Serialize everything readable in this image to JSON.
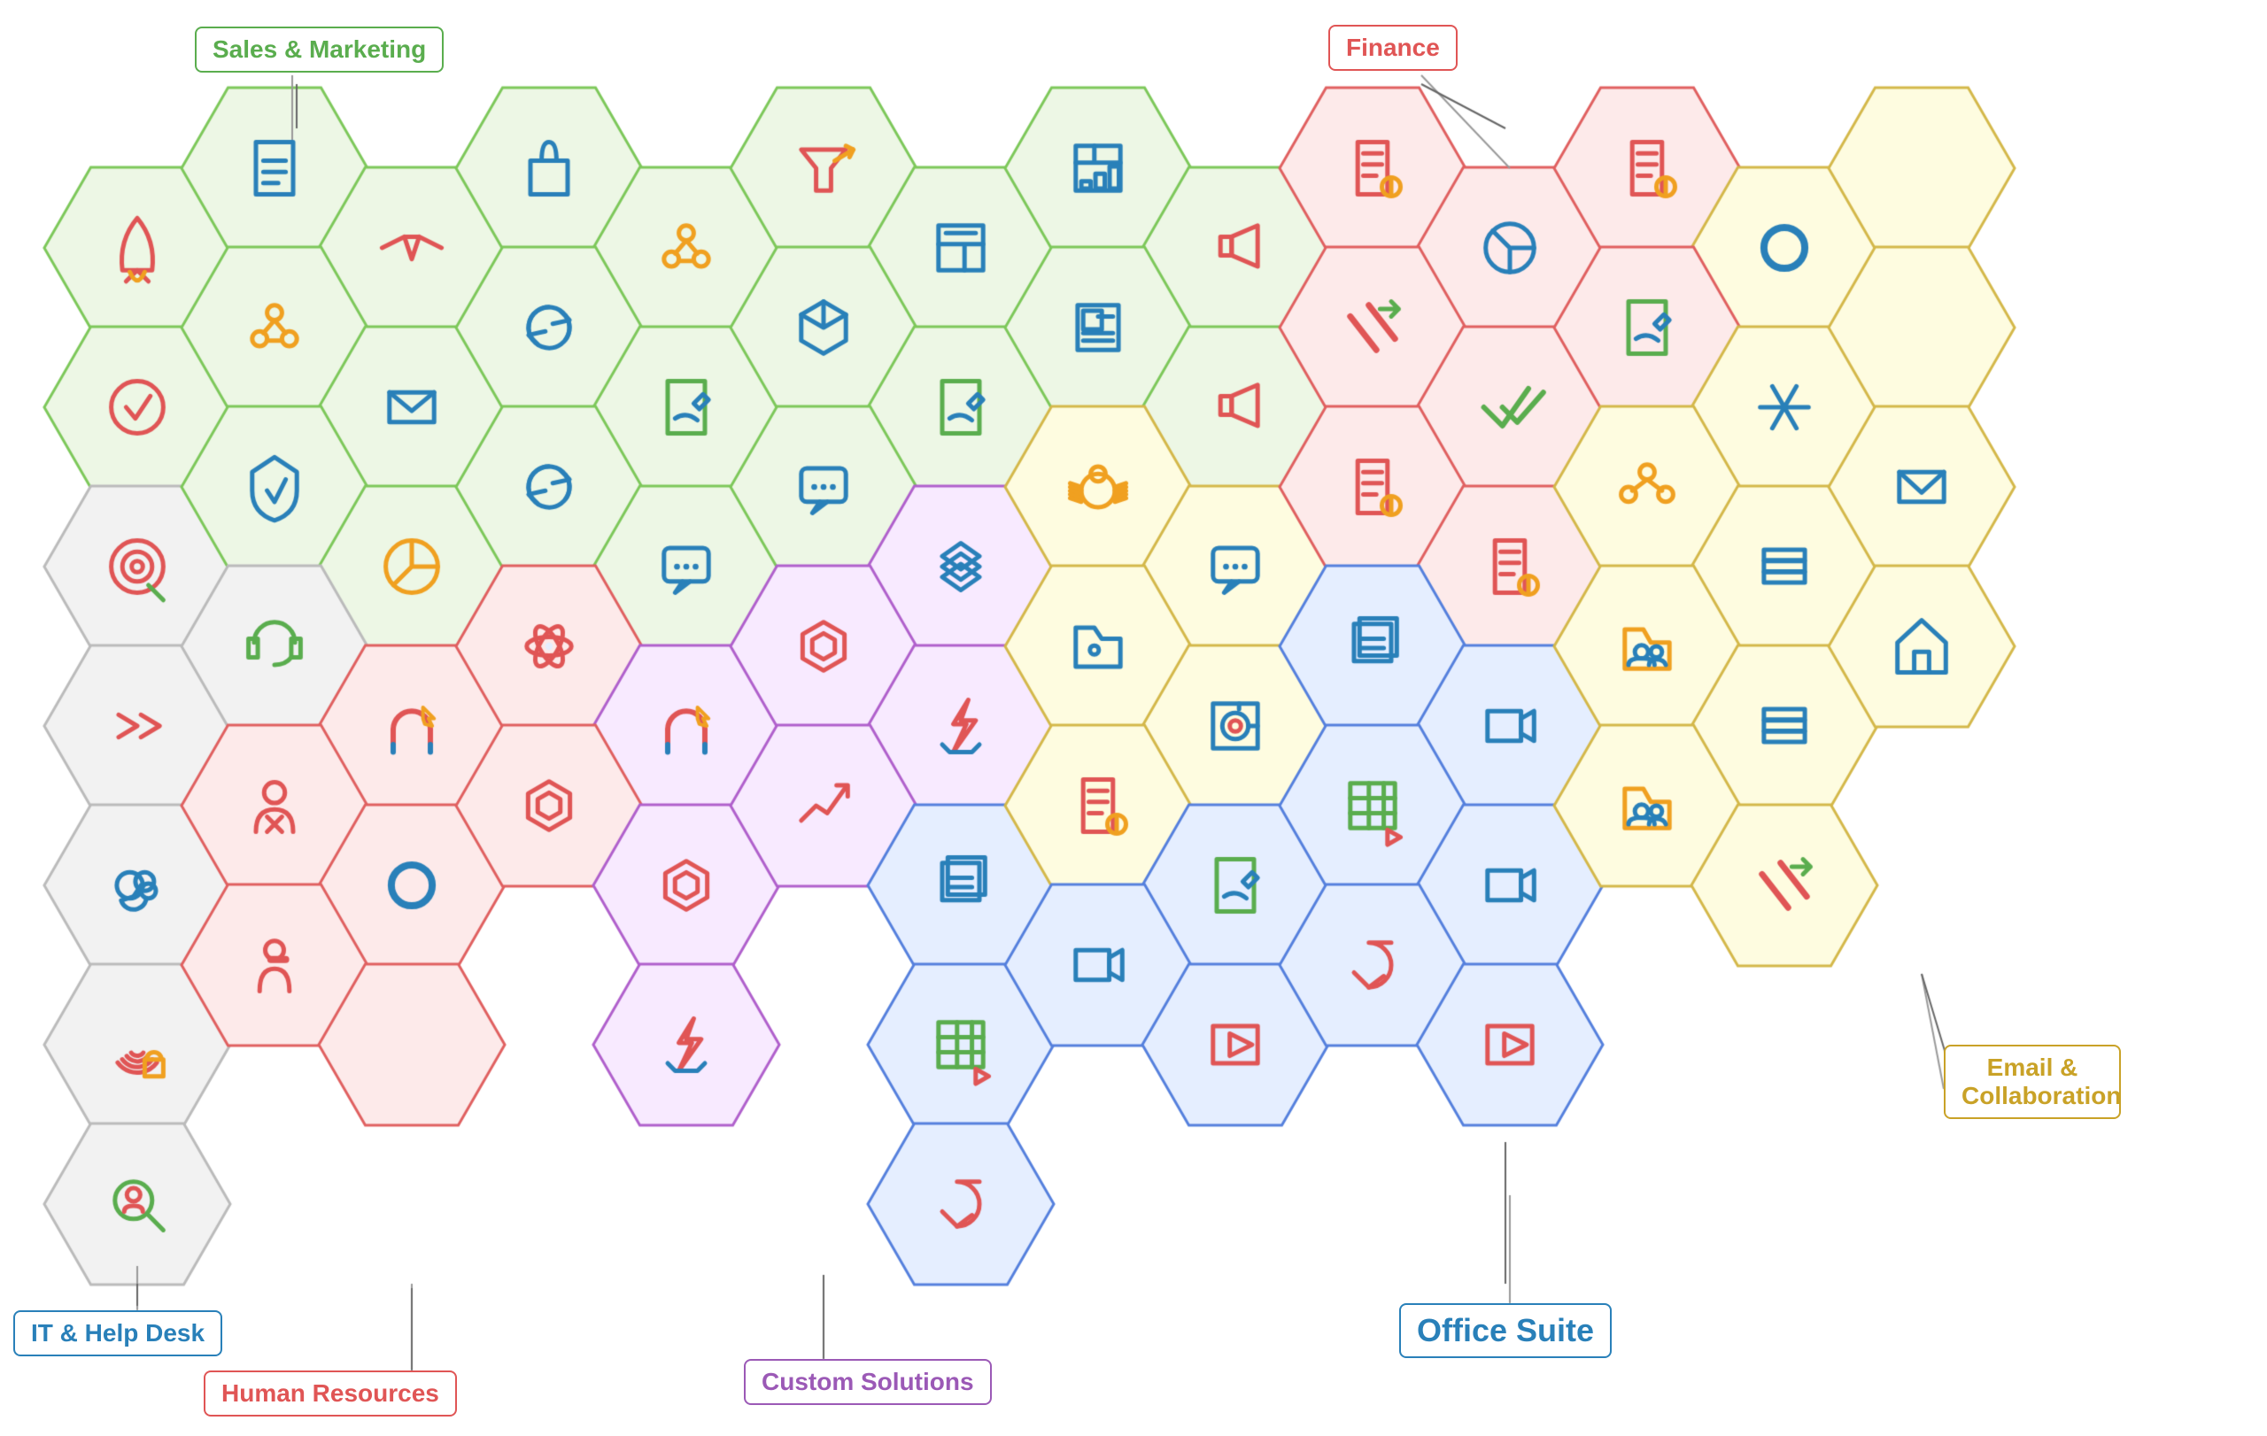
{
  "labels": {
    "sales_marketing": "Sales & Marketing",
    "it_help_desk": "IT & Help Desk",
    "human_resources": "Human Resources",
    "custom_solutions": "Custom Solutions",
    "finance": "Finance",
    "email_collaboration": "Email & Collaboration",
    "office_suite": "Office Suite"
  },
  "colors": {
    "green_bg": "#e8f5e2",
    "green_stroke": "#7dc55a",
    "red_bg": "#fde8e8",
    "red_stroke": "#e05555",
    "blue_bg": "#e3eeff",
    "blue_stroke": "#5588dd",
    "yellow_bg": "#fefbe0",
    "yellow_stroke": "#d4b84a",
    "purple_bg": "#f5e8ff",
    "purple_stroke": "#b060d0",
    "gray_bg": "#f0f0f0",
    "gray_stroke": "#aaaaaa"
  }
}
